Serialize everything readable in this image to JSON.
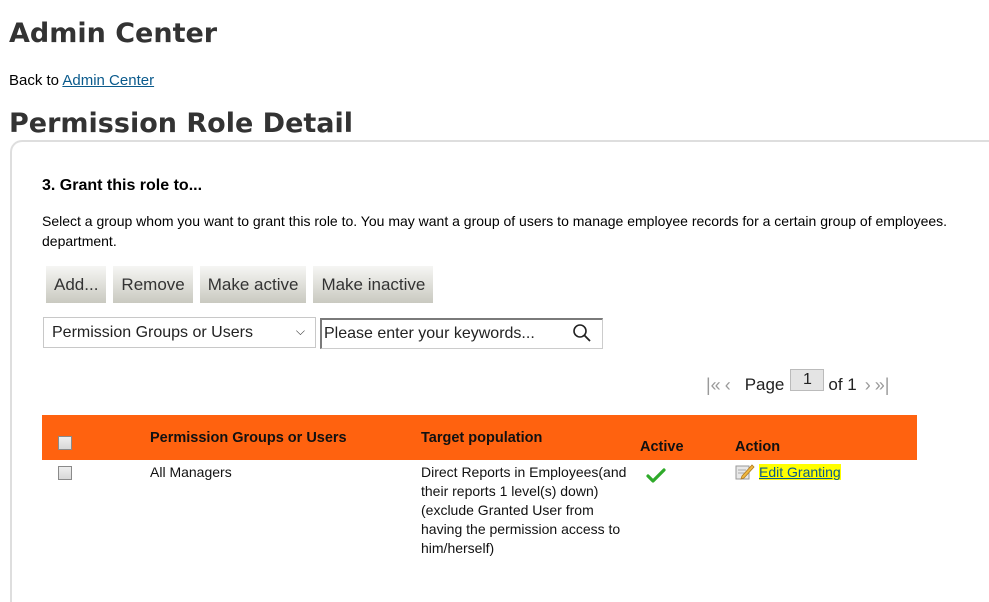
{
  "header": {
    "title": "Admin Center",
    "back_prefix": "Back to",
    "back_link": "Admin Center",
    "page_title": "Permission Role Detail"
  },
  "section": {
    "title": "3. Grant this role to...",
    "description": "Select a group whom you want to grant this role to. You may want a group of users to manage employee records for a certain group of employees. department."
  },
  "toolbar": {
    "add_label": "Add...",
    "remove_label": "Remove",
    "make_active_label": "Make active",
    "make_inactive_label": "Make inactive"
  },
  "filter": {
    "selected": "Permission Groups or Users",
    "search_placeholder": "Please enter your keywords...",
    "search_value": ""
  },
  "pagination": {
    "first_icon": "first-page-icon",
    "prev_icon": "prev-page-icon",
    "page_label": "Page",
    "current_page": "1",
    "of_label": "of 1",
    "next_icon": "next-page-icon",
    "last_icon": "last-page-icon"
  },
  "table": {
    "accent_color": "#ff620f",
    "columns": [
      "Permission Groups or Users",
      "Target population",
      "Active",
      "Action"
    ],
    "rows": [
      {
        "group": "All Managers",
        "target": "Direct Reports in Employees(and their reports 1 level(s) down)(exclude Granted User from having the permission access to him/herself)",
        "active": true,
        "action_label": "Edit Granting"
      }
    ]
  }
}
